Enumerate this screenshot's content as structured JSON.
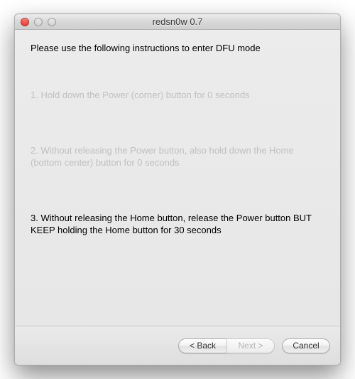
{
  "window": {
    "title": "redsn0w 0.7"
  },
  "content": {
    "header": "Please use the following instructions to enter DFU mode",
    "steps": [
      "1. Hold down the Power (corner) button for 0 seconds",
      "2. Without releasing the Power button, also hold down the Home (bottom center) button for 0 seconds",
      "3. Without releasing the Home button, release the Power button BUT KEEP holding the Home button for 30 seconds"
    ]
  },
  "footer": {
    "back_label": "< Back",
    "next_label": "Next >",
    "cancel_label": "Cancel"
  }
}
